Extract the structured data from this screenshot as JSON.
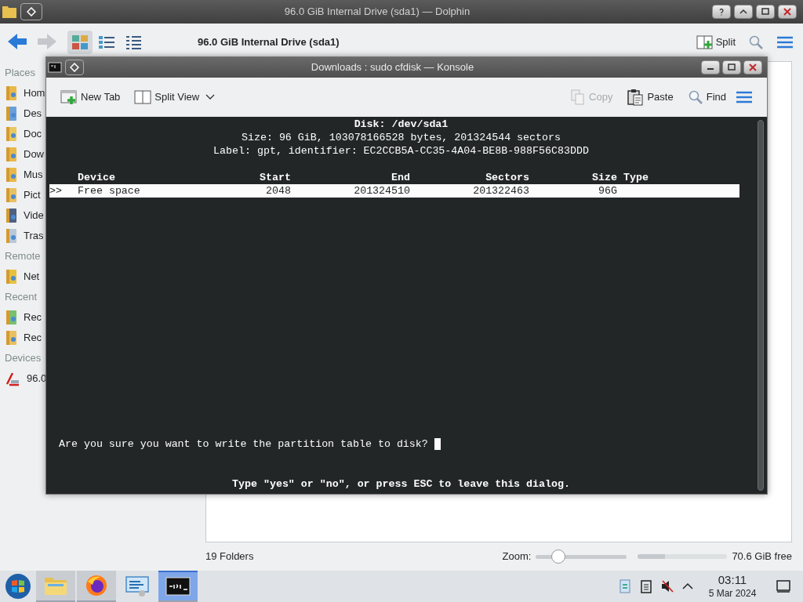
{
  "dolphin": {
    "title": "96.0 GiB Internal Drive (sda1) — Dolphin",
    "location": "96.0 GiB Internal Drive (sda1)",
    "split_label": "Split",
    "view_modes": [
      {
        "kind": "icons",
        "selected": true
      },
      {
        "kind": "compact",
        "selected": false
      },
      {
        "kind": "details",
        "selected": false
      }
    ],
    "sidebar": [
      {
        "heading": "Places",
        "items": [
          {
            "kind": "home",
            "label": "Hom"
          },
          {
            "kind": "desktop",
            "label": "Des"
          },
          {
            "kind": "documents",
            "label": "Doc"
          },
          {
            "kind": "downloads",
            "label": "Dow"
          },
          {
            "kind": "music",
            "label": "Mus"
          },
          {
            "kind": "pictures",
            "label": "Pict"
          },
          {
            "kind": "videos",
            "label": "Vide"
          },
          {
            "kind": "trash",
            "label": "Tras"
          }
        ]
      },
      {
        "heading": "Remote",
        "items": [
          {
            "kind": "network",
            "label": "Net"
          }
        ]
      },
      {
        "heading": "Recent",
        "items": [
          {
            "kind": "recent-files",
            "label": "Rec"
          },
          {
            "kind": "recent-locations",
            "label": "Rec"
          }
        ]
      },
      {
        "heading": "Devices",
        "items": [
          {
            "kind": "drive",
            "label": "96.0"
          }
        ]
      }
    ],
    "status_bar": {
      "folders": "19 Folders",
      "zoom_label": "Zoom:",
      "zoom": {
        "level": 0.2
      },
      "free_space": {
        "level": 0.3,
        "label": "70.6 GiB free"
      }
    }
  },
  "konsole": {
    "title": "Downloads : sudo cfdisk — Konsole",
    "toolbar": [
      {
        "kind": "new-tab",
        "label": "New Tab",
        "disabled": false
      },
      {
        "kind": "split-view",
        "label": "Split View",
        "disabled": false
      },
      {
        "kind": "copy",
        "label": "Copy",
        "disabled": true
      },
      {
        "kind": "paste",
        "label": "Paste",
        "disabled": false
      },
      {
        "kind": "find",
        "label": "Find",
        "disabled": false
      }
    ],
    "terminal": {
      "header": [
        "Disk: /dev/sda1",
        "Size: 96 GiB, 103078166528 bytes, 201324544 sectors",
        "Label: gpt, identifier: EC2CCB5A-CC35-4A04-BE8B-988F56C83DDD"
      ],
      "columns": [
        "Device",
        "Start",
        "End",
        "Sectors",
        "Size",
        "Type"
      ],
      "rows": [
        {
          "marker": ">>",
          "selected": true,
          "cells": [
            "Free space",
            "2048",
            "201324510",
            "201322463",
            "96G",
            ""
          ]
        }
      ],
      "prompt": "Are you sure you want to write the partition table to disk?",
      "hint": "Type \"yes\" or \"no\", or press ESC to leave this dialog."
    }
  },
  "taskbar": {
    "apps": [
      {
        "kind": "files",
        "open": true,
        "selected": false
      },
      {
        "kind": "browser",
        "open": true,
        "selected": false
      },
      {
        "kind": "system",
        "open": false,
        "selected": false
      },
      {
        "kind": "terminal",
        "open": true,
        "selected": true
      }
    ],
    "clock": {
      "time": "03:11",
      "date": "5 Mar 2024"
    }
  }
}
